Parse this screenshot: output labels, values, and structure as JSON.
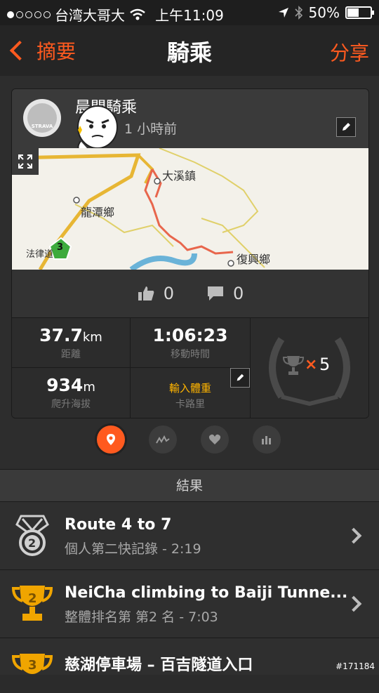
{
  "status_bar": {
    "carrier": "台湾大哥大",
    "time": "上午11:09",
    "battery": "50%"
  },
  "nav": {
    "back_label": "摘要",
    "title": "騎乘",
    "share_label": "分享"
  },
  "activity": {
    "avatar_text": "STRAVA",
    "title": "晨間騎乘",
    "time_ago": "1 小時前",
    "map_labels": {
      "a": "大溪鎮",
      "b": "龍潭鄉",
      "c": "復興鄉",
      "d": "法律道",
      "route_badge": "3"
    },
    "likes": "0",
    "comments": "0"
  },
  "stats": {
    "distance": {
      "value": "37.7",
      "unit": "km",
      "label": "距離"
    },
    "moving_time": {
      "value": "1:06:23",
      "label": "移動時間"
    },
    "elevation": {
      "value": "934",
      "unit": "m",
      "label": "爬升海拔"
    },
    "calories": {
      "action": "輸入體重",
      "label": "卡路里"
    },
    "achievements": {
      "count": "5",
      "multiplier": "×"
    }
  },
  "tabs": [
    "map",
    "analysis",
    "heart",
    "segments"
  ],
  "results_header": "結果",
  "results": [
    {
      "title": "Route 4 to 7",
      "subtitle": "個人第二快記錄 - 2:19",
      "rank": "2",
      "medal": "silver"
    },
    {
      "title": "NeiCha climbing to Baiji Tunne...",
      "subtitle": "整體排名第 第2 名 - 7:03",
      "rank": "2",
      "medal": "gold"
    },
    {
      "title": "慈湖停車場 – 百吉隧道入口",
      "subtitle": "",
      "rank": "3",
      "medal": "gold"
    }
  ],
  "watermark": "#171184",
  "colors": {
    "accent": "#ff5a1f",
    "gold": "#f0a500",
    "weight": "#ffb400"
  }
}
